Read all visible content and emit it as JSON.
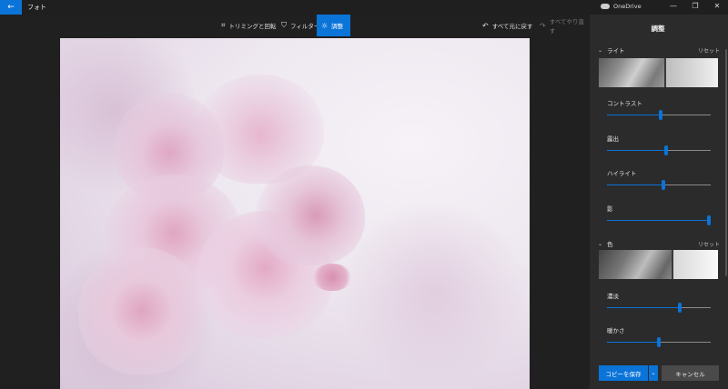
{
  "app": {
    "title": "フォト"
  },
  "titlebar": {
    "onedrive_label": "OneDrive",
    "minimize": "—",
    "maximize": "❐",
    "close": "✕",
    "back_icon": "←"
  },
  "toolbar": {
    "crop_icon": "⌗",
    "crop_label": "トリミングと回転",
    "filter_icon": "⛉",
    "filter_label": "フィルター",
    "adjust_icon": "☼",
    "adjust_label": "調整",
    "undo_icon": "↶",
    "undo_label": "すべて元に戻す",
    "redo_icon": "↷",
    "redo_label": "すべてやり直す"
  },
  "panel": {
    "title": "調整",
    "light": {
      "label": "ライト",
      "reset": "リセット",
      "chevron": "⌄",
      "sliders": [
        {
          "label": "コントラスト",
          "value": 0.52
        },
        {
          "label": "露出",
          "value": 0.57
        },
        {
          "label": "ハイライト",
          "value": 0.54
        },
        {
          "label": "影",
          "value": 0.98
        }
      ]
    },
    "color": {
      "label": "色",
      "reset": "リセット",
      "chevron": "⌄",
      "sliders": [
        {
          "label": "濃淡",
          "value": 0.7
        },
        {
          "label": "暖かさ",
          "value": 0.5
        }
      ]
    },
    "save_label": "コピーを保存",
    "save_dropdown_icon": "⌄",
    "cancel_label": "キャンセル"
  },
  "colors": {
    "accent": "#0a74d8",
    "background": "#1f1f1f",
    "panel": "#2b2b2b"
  }
}
